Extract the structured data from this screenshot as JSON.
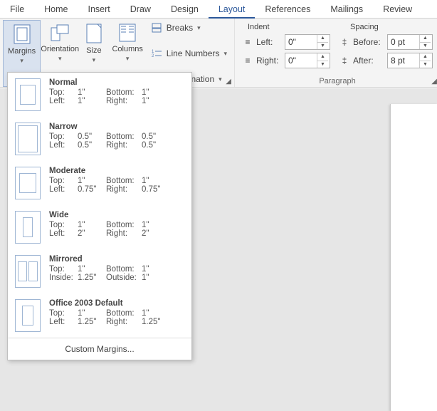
{
  "tabs": [
    "File",
    "Home",
    "Insert",
    "Draw",
    "Design",
    "Layout",
    "References",
    "Mailings",
    "Review"
  ],
  "active_tab": "Layout",
  "ribbon": {
    "margins": "Margins",
    "orientation": "Orientation",
    "size": "Size",
    "columns": "Columns",
    "breaks": "Breaks",
    "linenumbers": "Line Numbers",
    "hyphenation": "Hyphenation",
    "indent_title": "Indent",
    "spacing_title": "Spacing",
    "left": "Left:",
    "right": "Right:",
    "before": "Before:",
    "after": "After:",
    "indent_left_val": "0\"",
    "indent_right_val": "0\"",
    "spacing_before_val": "0 pt",
    "spacing_after_val": "8 pt",
    "paragraph": "Paragraph"
  },
  "presets": [
    {
      "name": "Normal",
      "k1": "Top:",
      "v1": "1\"",
      "k2": "Bottom:",
      "v2": "1\"",
      "k3": "Left:",
      "v3": "1\"",
      "k4": "Right:",
      "v4": "1\"",
      "m": {
        "t": 8,
        "b": 8,
        "l": 6,
        "r": 6
      }
    },
    {
      "name": "Narrow",
      "k1": "Top:",
      "v1": "0.5\"",
      "k2": "Bottom:",
      "v2": "0.5\"",
      "k3": "Left:",
      "v3": "0.5\"",
      "k4": "Right:",
      "v4": "0.5\"",
      "m": {
        "t": 3,
        "b": 3,
        "l": 3,
        "r": 3
      }
    },
    {
      "name": "Moderate",
      "k1": "Top:",
      "v1": "1\"",
      "k2": "Bottom:",
      "v2": "1\"",
      "k3": "Left:",
      "v3": "0.75\"",
      "k4": "Right:",
      "v4": "0.75\"",
      "m": {
        "t": 8,
        "b": 8,
        "l": 5,
        "r": 5
      }
    },
    {
      "name": "Wide",
      "k1": "Top:",
      "v1": "1\"",
      "k2": "Bottom:",
      "v2": "1\"",
      "k3": "Left:",
      "v3": "2\"",
      "k4": "Right:",
      "v4": "2\"",
      "m": {
        "t": 8,
        "b": 8,
        "l": 10,
        "r": 10
      }
    },
    {
      "name": "Mirrored",
      "k1": "Top:",
      "v1": "1\"",
      "k2": "Bottom:",
      "v2": "1\"",
      "k3": "Inside:",
      "v3": "1.25\"",
      "k4": "Outside:",
      "v4": "1\"",
      "m": {
        "t": 8,
        "b": 8,
        "l": 9,
        "r": 6
      },
      "mirror": true
    },
    {
      "name": "Office 2003 Default",
      "k1": "Top:",
      "v1": "1\"",
      "k2": "Bottom:",
      "v2": "1\"",
      "k3": "Left:",
      "v3": "1.25\"",
      "k4": "Right:",
      "v4": "1.25\"",
      "m": {
        "t": 8,
        "b": 8,
        "l": 9,
        "r": 9
      }
    }
  ],
  "custom_margins": "Custom Margins..."
}
